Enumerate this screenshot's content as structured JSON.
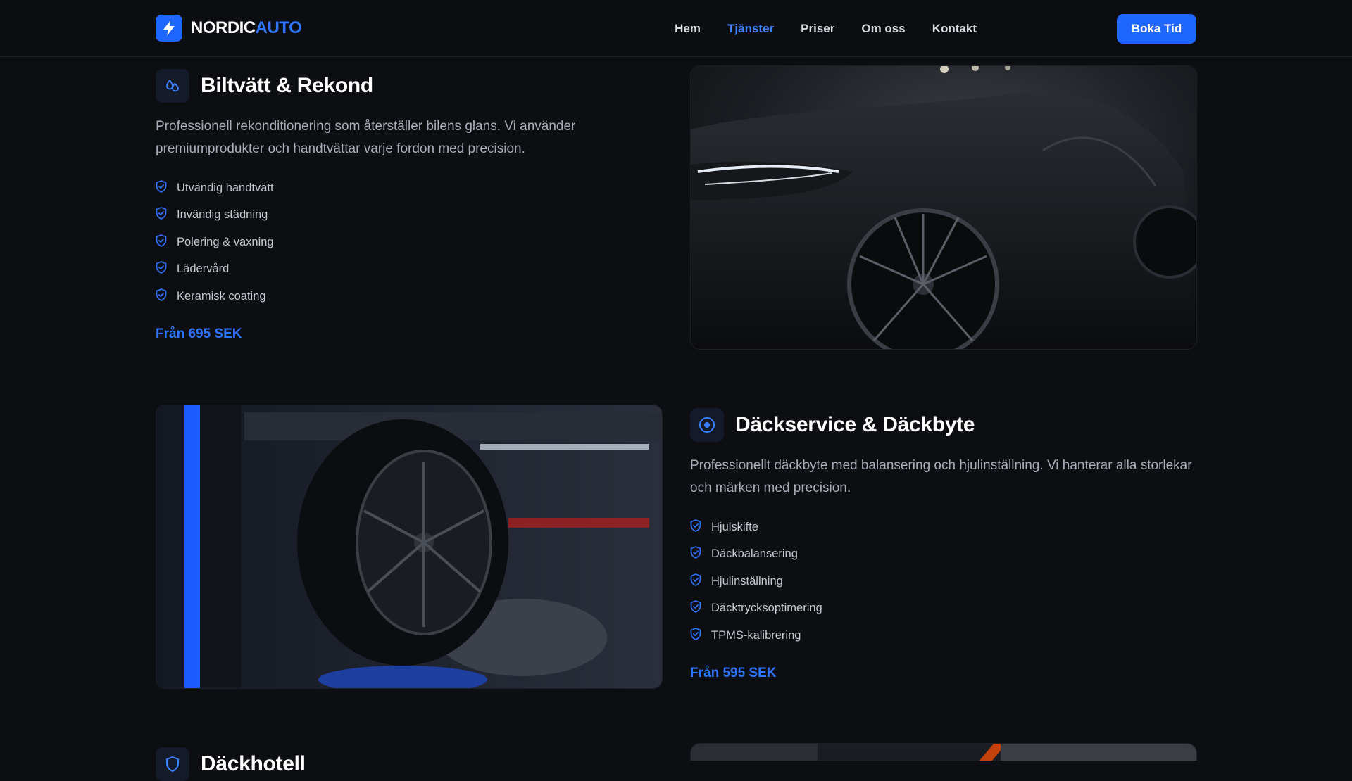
{
  "brand": {
    "name_part1": "NORDIC",
    "name_part2": "AUTO",
    "accent": "#1f66ff"
  },
  "nav": {
    "items": [
      {
        "label": "Hem",
        "active": false
      },
      {
        "label": "Tjänster",
        "active": true
      },
      {
        "label": "Priser",
        "active": false
      },
      {
        "label": "Om oss",
        "active": false
      },
      {
        "label": "Kontakt",
        "active": false
      }
    ],
    "cta_label": "Boka Tid"
  },
  "services": [
    {
      "icon": "droplets-icon",
      "title": "Biltvätt & Rekond",
      "desc_line1": "Professionell rekonditionering som återställer bilens glans. Vi använder",
      "desc_line2": "premiumprodukter och handtvättar varje fordon med precision.",
      "features": [
        "Utvändig handtvätt",
        "Invändig städning",
        "Polering & vaxning",
        "Lädervård",
        "Keramisk coating"
      ],
      "price": "Från 695 SEK",
      "image": "wet-black-car-photo"
    },
    {
      "icon": "target-icon",
      "title": "Däckservice & Däckbyte",
      "desc_line1": "Professionellt däckbyte med balansering och hjulinställning. Vi hanterar alla storlekar",
      "desc_line2": "och märken med precision.",
      "features": [
        "Hjulskifte",
        "Däckbalansering",
        "Hjulinställning",
        "Däcktrycksoptimering",
        "TPMS-kalibrering"
      ],
      "price": "Från 595 SEK",
      "image": "tire-on-balancer-photo"
    },
    {
      "icon": "shield-icon",
      "title": "Däckhotell",
      "image": "stored-tires-photo"
    }
  ]
}
